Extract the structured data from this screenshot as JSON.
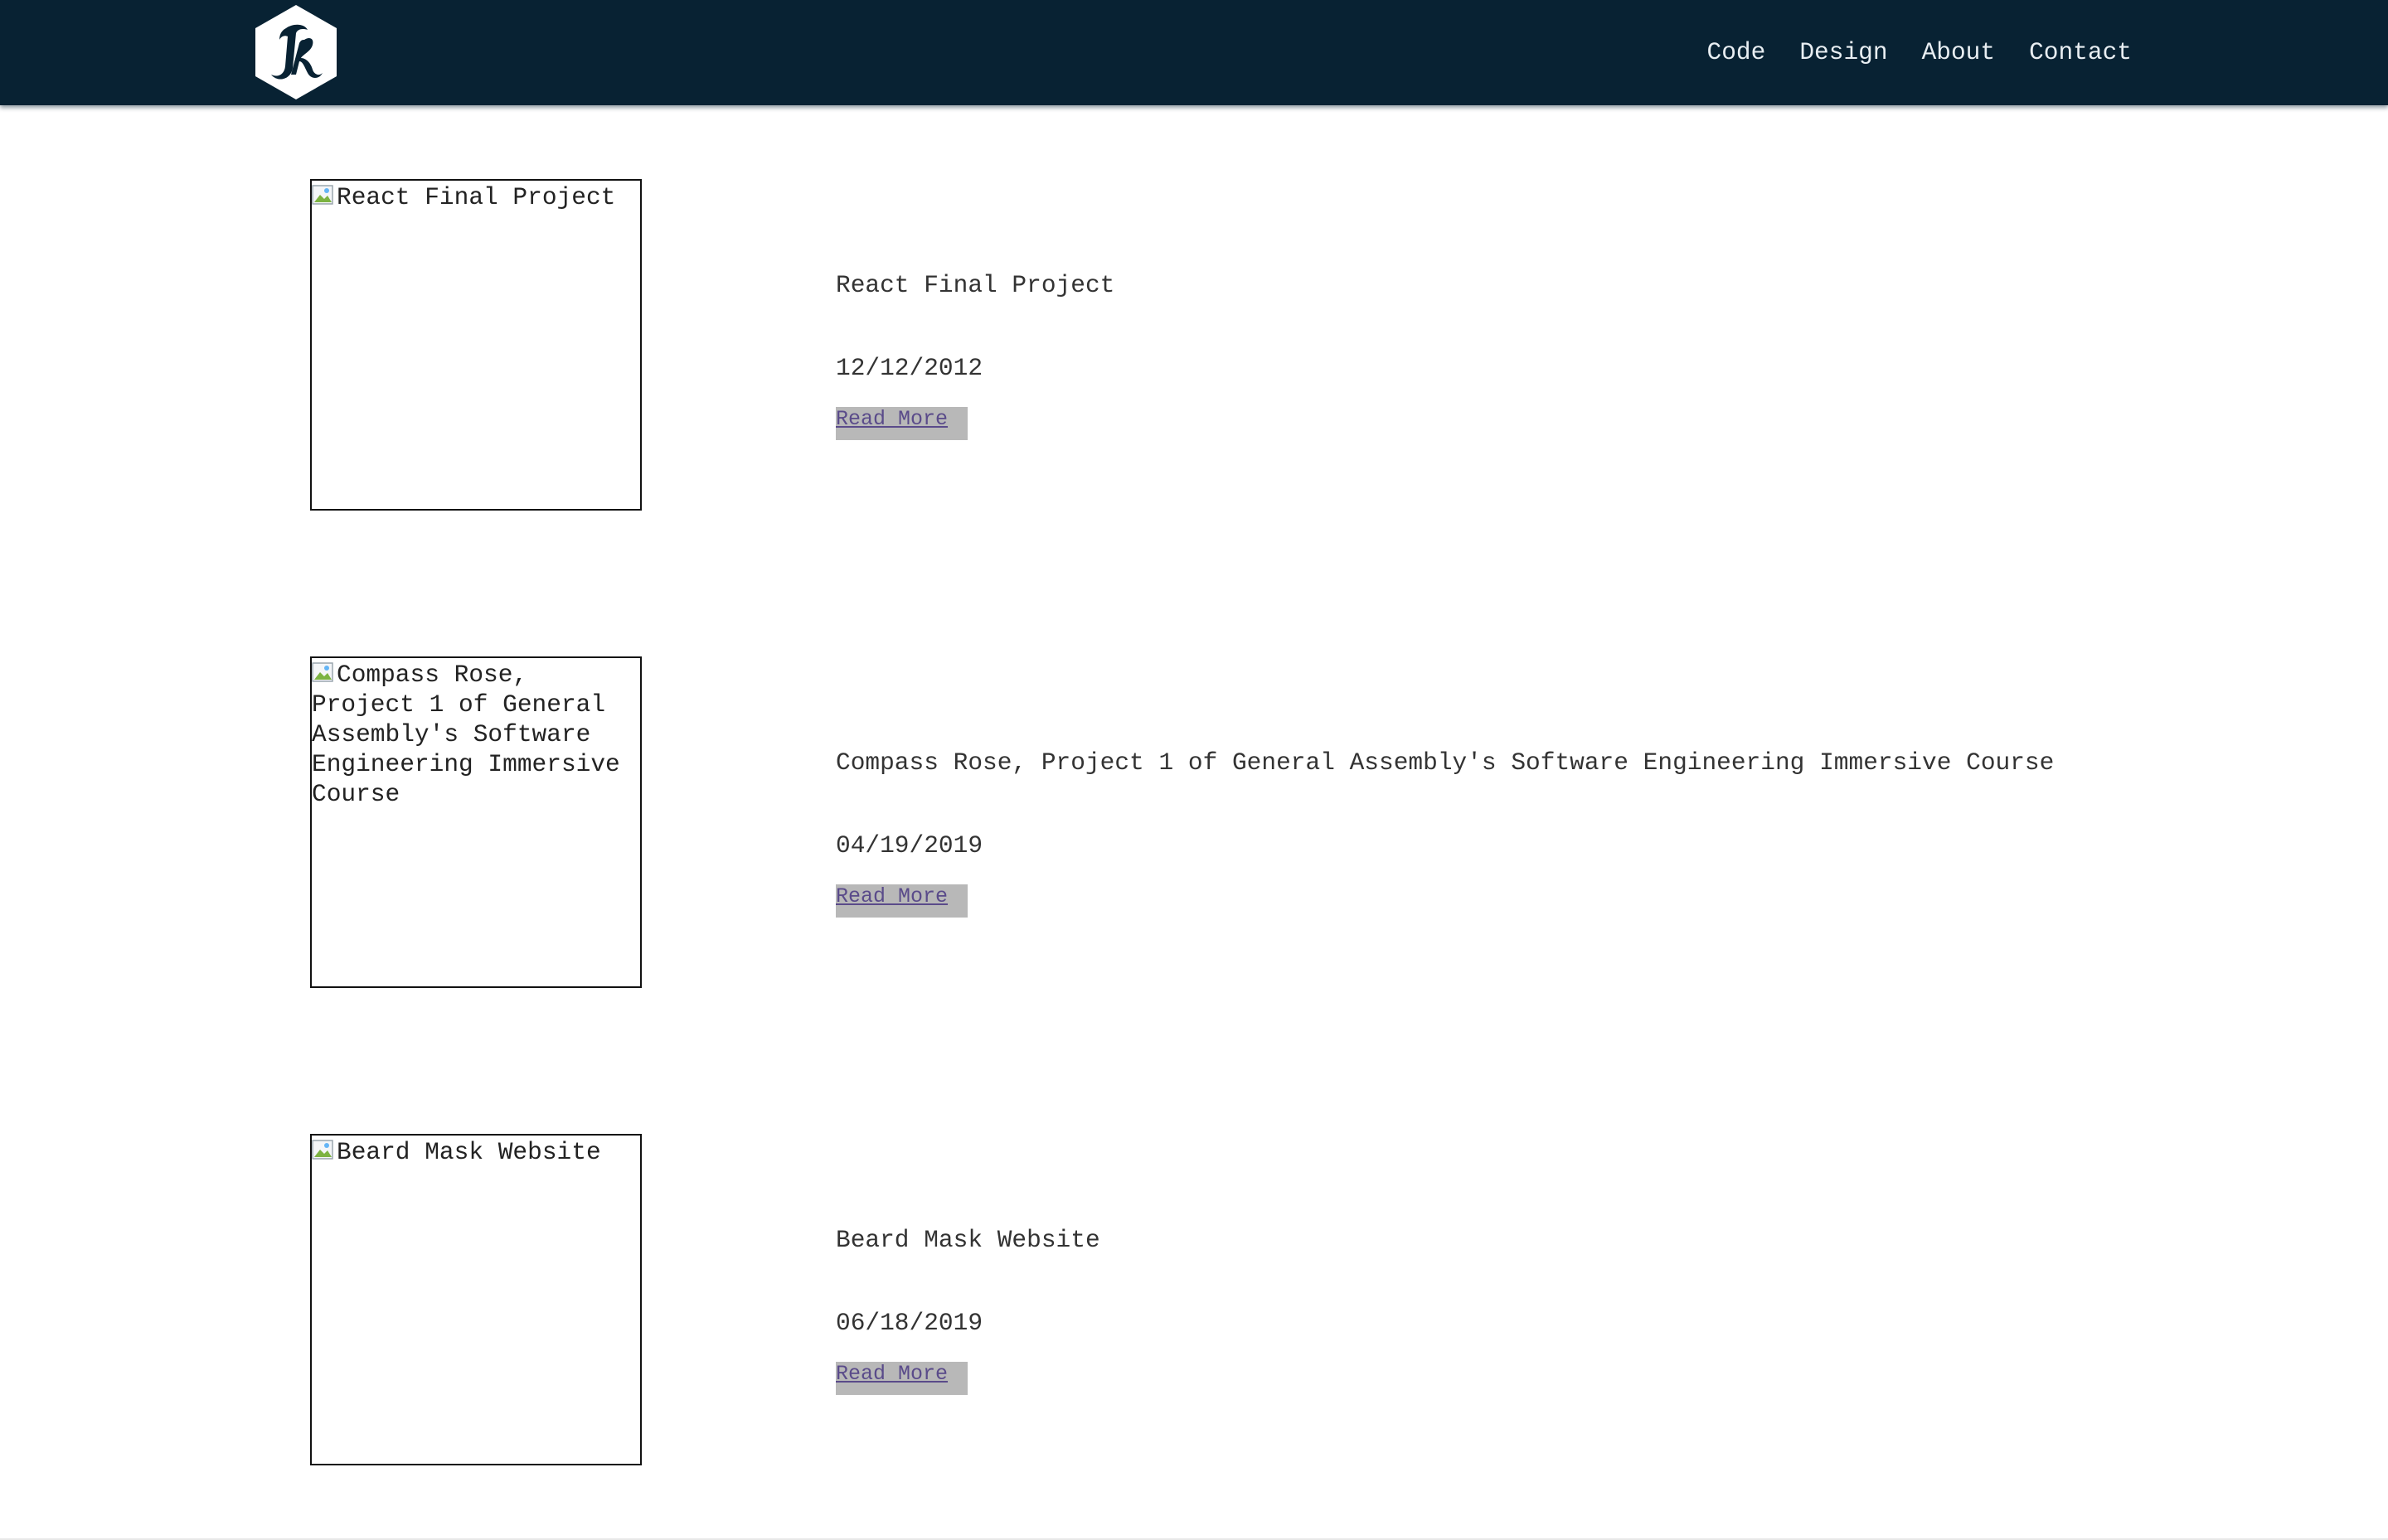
{
  "header": {
    "logo_icon": "jk-hexagon-logo-icon",
    "nav": [
      {
        "label": "Code"
      },
      {
        "label": "Design"
      },
      {
        "label": "About"
      },
      {
        "label": "Contact"
      }
    ]
  },
  "projects": [
    {
      "image_alt": "React Final Project",
      "title": "React Final Project",
      "date": "12/12/2012",
      "link_label": "Read More"
    },
    {
      "image_alt": "Compass Rose, Project 1 of General Assembly's Software Engineering Immersive Course",
      "title": "Compass Rose, Project 1 of General Assembly's Software Engineering Immersive Course",
      "date": "04/19/2019",
      "link_label": "Read More"
    },
    {
      "image_alt": "Beard Mask Website",
      "title": "Beard Mask Website",
      "date": "06/18/2019",
      "link_label": "Read More"
    }
  ],
  "colors": {
    "navbar_bg": "#082233",
    "nav_text": "#e8eef2",
    "button_bg": "#b8b8b8",
    "link_text": "#5a4b8a"
  }
}
